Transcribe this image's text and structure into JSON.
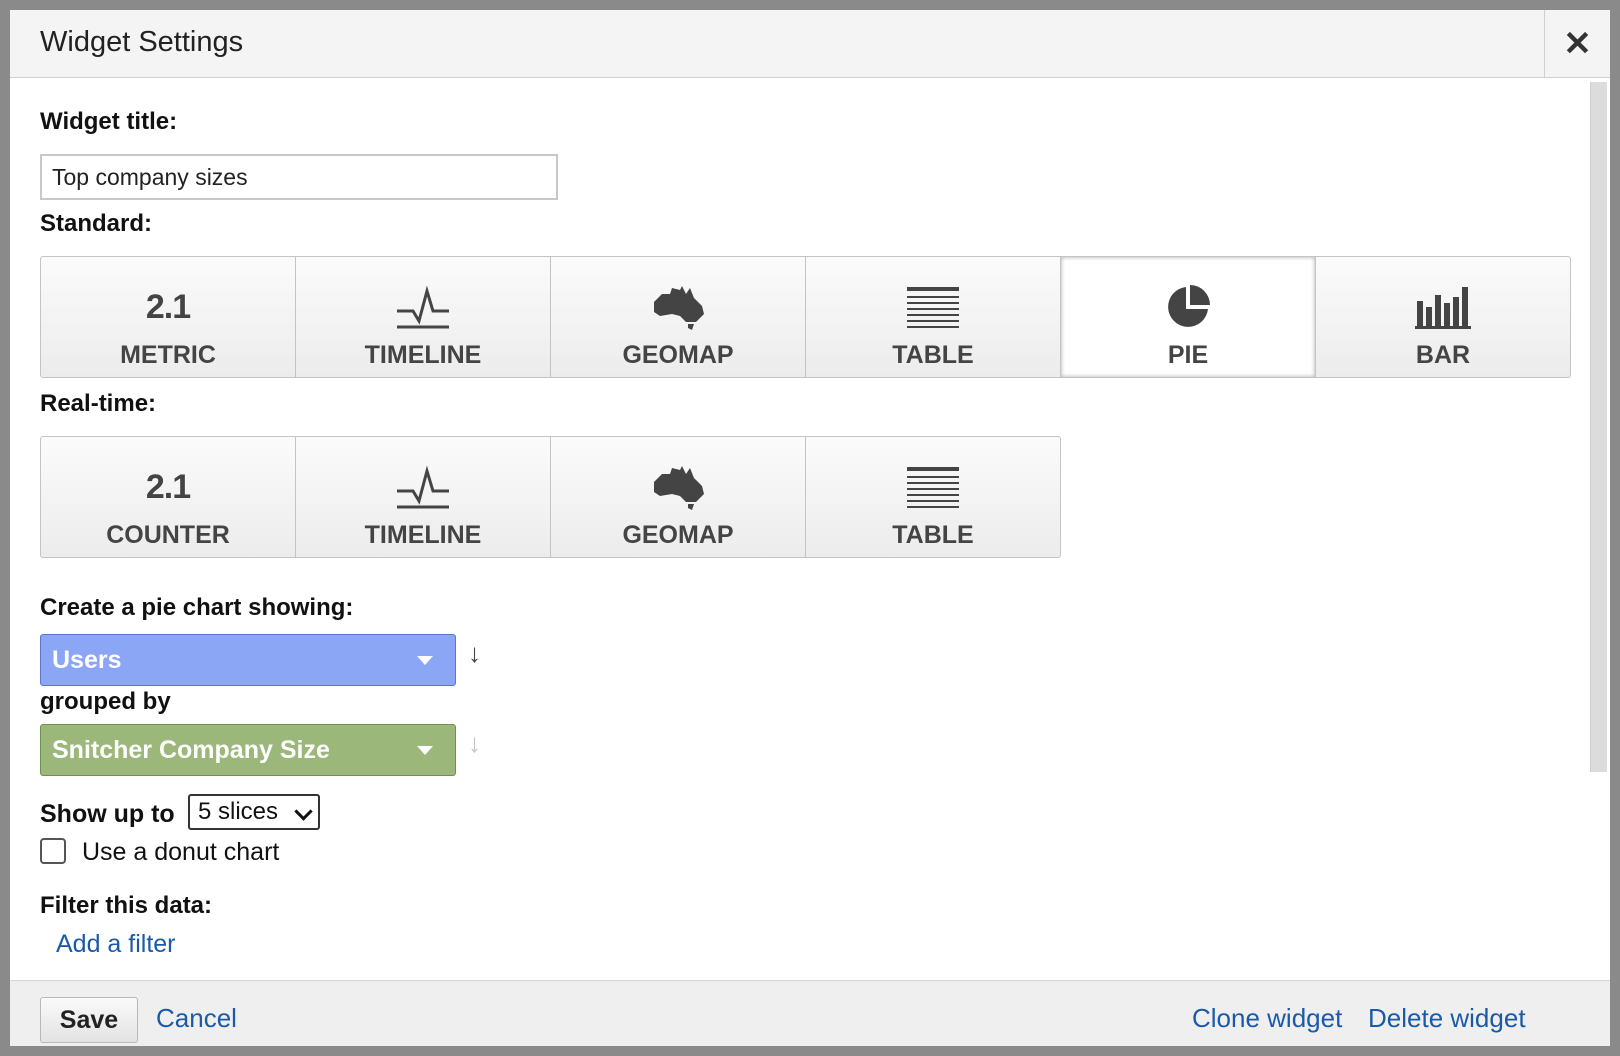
{
  "dialog": {
    "title": "Widget Settings",
    "close_label": "✕"
  },
  "form": {
    "widget_title_label": "Widget title:",
    "widget_title_value": "Top company sizes",
    "standard_label": "Standard:",
    "standard_types": [
      {
        "icon": "metric-icon",
        "icon_text": "2.1",
        "label": "METRIC",
        "selected": false
      },
      {
        "icon": "timeline-icon",
        "label": "TIMELINE",
        "selected": false
      },
      {
        "icon": "geomap-icon",
        "label": "GEOMAP",
        "selected": false
      },
      {
        "icon": "table-icon",
        "label": "TABLE",
        "selected": false
      },
      {
        "icon": "pie-icon",
        "label": "PIE",
        "selected": true
      },
      {
        "icon": "bar-icon",
        "label": "BAR",
        "selected": false
      }
    ],
    "realtime_label": "Real-time:",
    "realtime_types": [
      {
        "icon": "counter-icon",
        "icon_text": "2.1",
        "label": "COUNTER"
      },
      {
        "icon": "timeline-icon",
        "label": "TIMELINE"
      },
      {
        "icon": "geomap-icon",
        "label": "GEOMAP"
      },
      {
        "icon": "table-icon",
        "label": "TABLE"
      }
    ],
    "pie_showing_label": "Create a pie chart showing:",
    "metric_select": "Users",
    "grouped_by_label": "grouped by",
    "dimension_select": "Snitcher Company Size",
    "show_up_to_label": "Show up to",
    "slices_value": "5 slices",
    "donut_label": "Use a donut chart",
    "donut_checked": false,
    "filter_label": "Filter this data:",
    "add_filter_link": "Add a filter"
  },
  "footer": {
    "save_label": "Save",
    "cancel_label": "Cancel",
    "clone_label": "Clone widget",
    "delete_label": "Delete widget"
  },
  "colors": {
    "metric_select": "#8aa6f5",
    "dimension_select": "#9bb77a",
    "link": "#1a5aa8"
  }
}
